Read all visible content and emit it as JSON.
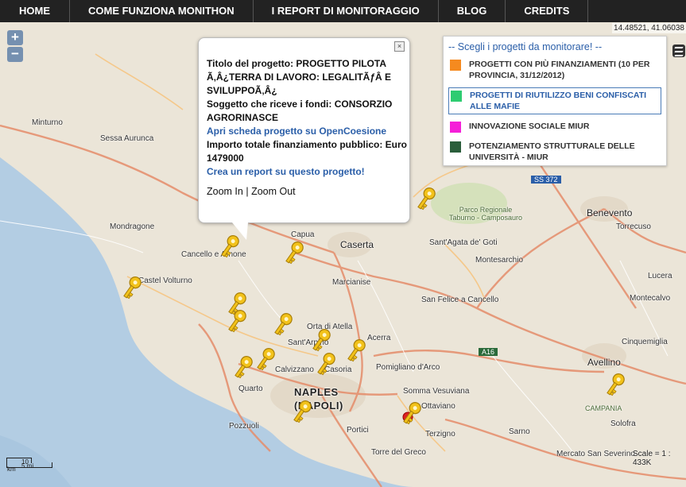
{
  "nav": {
    "items": [
      "HOME",
      "COME FUNZIONA MONITHON",
      "I REPORT DI MONITORAGGIO",
      "BLOG",
      "CREDITS"
    ]
  },
  "map": {
    "coords": "14.48521, 41.06038",
    "zoom_in": "+",
    "zoom_out": "−",
    "scale_km": "10 km",
    "scale_mi": "5 mi",
    "scale_text": "Scale = 1 : 433K",
    "labels": {
      "minturno": "Minturno",
      "sessa": "Sessa Aurunca",
      "mondragone": "Mondragone",
      "cancello": "Cancello e Arnone",
      "volturno": "Castel Volturno",
      "capua": "Capua",
      "caserta": "Caserta",
      "marcianise": "Marcianise",
      "santagata": "Sant'Agata de' Goti",
      "montesarchio": "Montesarchio",
      "sanfelice": "San Felice a Cancello",
      "benevento": "Benevento",
      "avellino": "Avellino",
      "naples": "NAPLES",
      "napoli": "(NAPOLI)",
      "quarto": "Quarto",
      "pozzuoli": "Pozzuoli",
      "calvizzano": "Calvizzano",
      "casoria": "Casoria",
      "acerra": "Acerra",
      "orta": "Orta di Atella",
      "santantimo": "Sant'Arpino",
      "pomigliano": "Pomigliano d'Arco",
      "somma": "Somma Vesuviana",
      "ottaviano": "Ottaviano",
      "terzigno": "Terzigno",
      "portici": "Portici",
      "torre": "Torre del Greco",
      "sarno": "Sarno",
      "mercato": "Mercato San Severino",
      "solofra": "Solofra",
      "campania": "CAMPANIA",
      "parco": "Parco Regionale\nTaburno - Camposauro",
      "ss372": "SS 372",
      "a16": "A16",
      "torrecuso": "Torrecuso",
      "montecalvo": "Montecalvo",
      "lucera": "Lucera",
      "cinquemiglia": "Cinquemiglia"
    }
  },
  "popup": {
    "title_line": "Titolo del progetto: PROGETTO PILOTA Ã‚Â¿TERRA DI LAVORO: LEGALITÃƒÂ  E SVILUPPOÃ‚Â¿",
    "recipient_line": "Soggetto che riceve i fondi: CONSORZIO AGRORINASCE",
    "open_link": "Apri scheda progetto su OpenCoesione",
    "amount_line": "Importo totale finanziamento pubblico: Euro 1479000",
    "report_link": "Crea un report su questo progetto!",
    "zoom_in": "Zoom In",
    "separator": "|",
    "zoom_out": "Zoom Out",
    "close": "×"
  },
  "legend": {
    "title": "-- Scegli i progetti da monitorare! --",
    "items": [
      {
        "label": "PROGETTI CON PIÙ FINANZIAMENTI (10 PER PROVINCIA, 31/12/2012)",
        "color": "#f58a1f"
      },
      {
        "label": "PROGETTI DI RIUTILIZZO BENI CONFISCATI ALLE MAFIE",
        "color": "#2ecc71"
      },
      {
        "label": "INNOVAZIONE SOCIALE MIUR",
        "color": "#f51fd8"
      },
      {
        "label": "POTENZIAMENTO STRUTTURALE DELLE UNIVERSITÀ - MIUR",
        "color": "#2a5e3b"
      }
    ]
  }
}
